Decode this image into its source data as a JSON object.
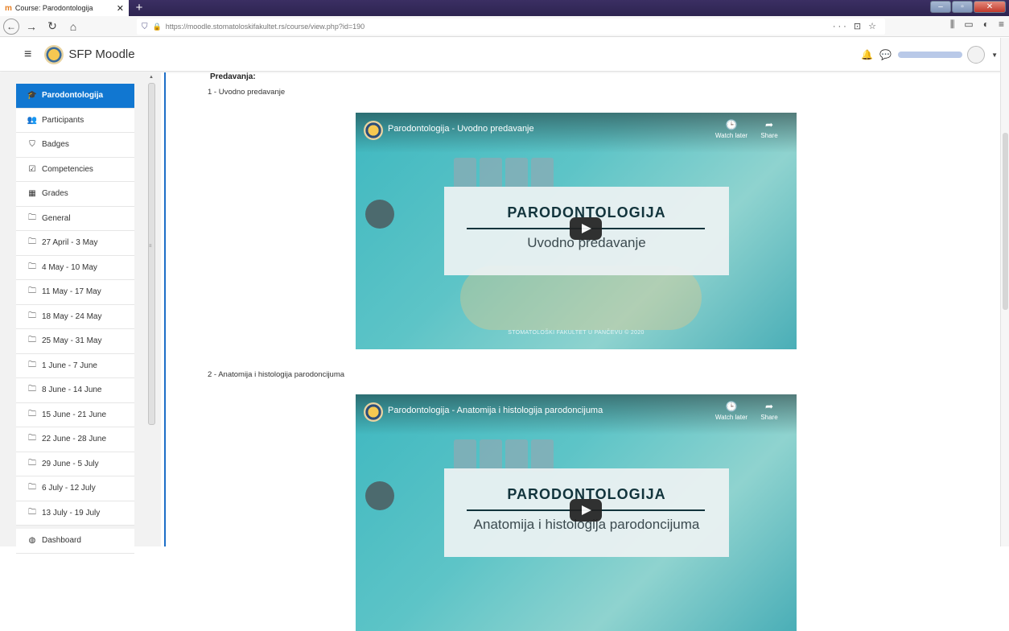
{
  "browser": {
    "tab_title": "Course: Parodontologija",
    "tab_favicon": "moodle-icon",
    "new_tab": "+",
    "close_glyph": "✕",
    "url": "https://moodle.stomatoloskifakultet.rs/course/view.php?id=190",
    "url_actions": "··· ⊡ ☆"
  },
  "header": {
    "site_name": "SFP Moodle",
    "menu_icon": "hamburger-icon"
  },
  "nav": {
    "items": [
      {
        "label": "Parodontologija",
        "icon": "mortarboard-icon",
        "glyph": "🎓",
        "active": true
      },
      {
        "label": "Participants",
        "icon": "users-icon",
        "glyph": "👥"
      },
      {
        "label": "Badges",
        "icon": "shield-icon",
        "glyph": "⛉"
      },
      {
        "label": "Competencies",
        "icon": "checkbox-icon",
        "glyph": "☑"
      },
      {
        "label": "Grades",
        "icon": "table-icon",
        "glyph": "▦"
      },
      {
        "label": "General",
        "icon": "folder-icon",
        "glyph": "🗀"
      },
      {
        "label": "27 April - 3 May",
        "icon": "folder-icon",
        "glyph": "🗀"
      },
      {
        "label": "4 May - 10 May",
        "icon": "folder-icon",
        "glyph": "🗀"
      },
      {
        "label": "11 May - 17 May",
        "icon": "folder-icon",
        "glyph": "🗀"
      },
      {
        "label": "18 May - 24 May",
        "icon": "folder-icon",
        "glyph": "🗀"
      },
      {
        "label": "25 May - 31 May",
        "icon": "folder-icon",
        "glyph": "🗀"
      },
      {
        "label": "1 June - 7 June",
        "icon": "folder-icon",
        "glyph": "🗀"
      },
      {
        "label": "8 June - 14 June",
        "icon": "folder-icon",
        "glyph": "🗀"
      },
      {
        "label": "15 June - 21 June",
        "icon": "folder-icon",
        "glyph": "🗀"
      },
      {
        "label": "22 June - 28 June",
        "icon": "folder-icon",
        "glyph": "🗀"
      },
      {
        "label": "29 June - 5 July",
        "icon": "folder-icon",
        "glyph": "🗀"
      },
      {
        "label": "6 July - 12 July",
        "icon": "folder-icon",
        "glyph": "🗀"
      },
      {
        "label": "13 July - 19 July",
        "icon": "folder-icon",
        "glyph": "🗀"
      },
      {
        "label": "Dashboard",
        "icon": "dashboard-icon",
        "glyph": "◍"
      }
    ]
  },
  "content": {
    "section_label": "Predavanja:",
    "lectures": [
      {
        "label": "1 - Uvodno predavanje",
        "video_title": "Parodontologija - Uvodno predavanje",
        "card_title": "PARODONTOLOGIJA",
        "card_subtitle": "Uvodno predavanje",
        "footer": "STOMATOLOŠKI FAKULTET U PANČEVU © 2020",
        "watch_later": "Watch later",
        "share": "Share"
      },
      {
        "label": "2 - Anatomija i histologija parodoncijuma",
        "video_title": "Parodontologija - Anatomija i histologija parodoncijuma",
        "card_title": "PARODONTOLOGIJA",
        "card_subtitle": "Anatomija i histologija parodoncijuma",
        "watch_later": "Watch later",
        "share": "Share"
      }
    ]
  }
}
